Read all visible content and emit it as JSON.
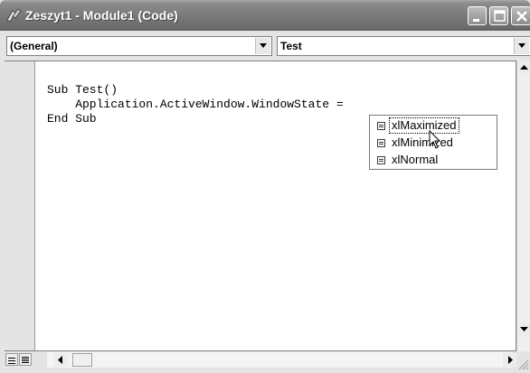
{
  "window": {
    "title": "Zeszyt1 - Module1 (Code)"
  },
  "combos": {
    "object": "(General)",
    "procedure": "Test"
  },
  "code": {
    "lines": [
      "Sub Test()",
      "    Application.ActiveWindow.WindowState =",
      "End Sub"
    ]
  },
  "autocomplete": {
    "items": [
      "xlMaximized",
      "xlMinimized",
      "xlNormal"
    ],
    "selected_index": 0,
    "item_icon": "enum-constant-icon"
  },
  "colors": {
    "title_bar": "#7a7a7a",
    "window_face": "#e4e4e4",
    "editor_bg": "#ffffff"
  }
}
